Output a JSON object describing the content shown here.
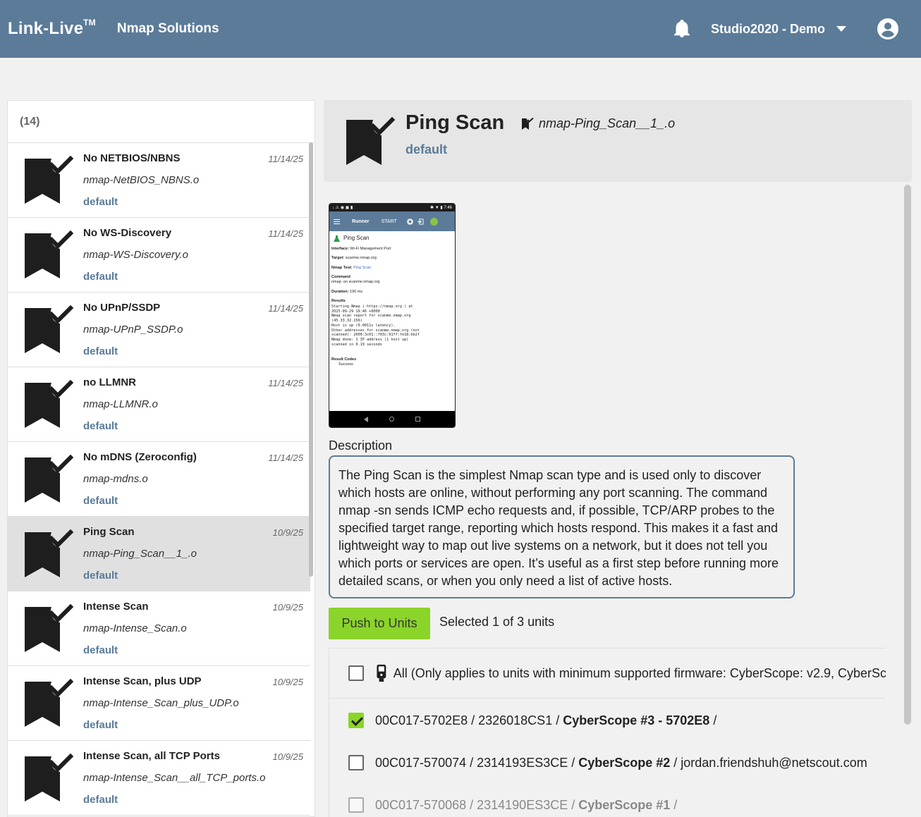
{
  "header": {
    "brand": "Link-Live",
    "brand_mark": "TM",
    "product": "Nmap Solutions",
    "org": "Studio2020 - Demo"
  },
  "list": {
    "count": "(14)",
    "items": [
      {
        "title": "No NETBIOS/NBNS",
        "file": "nmap-NetBIOS_NBNS.o",
        "tag": "default",
        "date": "11/14/25"
      },
      {
        "title": "No WS-Discovery",
        "file": "nmap-WS-Discovery.o",
        "tag": "default",
        "date": "11/14/25"
      },
      {
        "title": "No UPnP/SSDP",
        "file": "nmap-UPnP_SSDP.o",
        "tag": "default",
        "date": "11/14/25"
      },
      {
        "title": "no LLMNR",
        "file": "nmap-LLMNR.o",
        "tag": "default",
        "date": "11/14/25"
      },
      {
        "title": "No mDNS (Zeroconfig)",
        "file": "nmap-mdns.o",
        "tag": "default",
        "date": "11/14/25"
      },
      {
        "title": "Ping Scan",
        "file": "nmap-Ping_Scan__1_.o",
        "tag": "default",
        "date": "10/9/25"
      },
      {
        "title": "Intense Scan",
        "file": "nmap-Intense_Scan.o",
        "tag": "default",
        "date": "10/9/25"
      },
      {
        "title": "Intense Scan, plus UDP",
        "file": "nmap-Intense_Scan_plus_UDP.o",
        "tag": "default",
        "date": "10/9/25"
      },
      {
        "title": "Intense Scan, all TCP Ports",
        "file": "nmap-Intense_Scan__all_TCP_ports.o",
        "tag": "default",
        "date": "10/9/25"
      }
    ]
  },
  "detail": {
    "title": "Ping Scan",
    "file": "nmap-Ping_Scan__1_.o",
    "tag": "default",
    "description_label": "Description",
    "description": "The Ping Scan is the simplest Nmap scan type and is used only to discover which hosts are online, without performing any port scanning. The command nmap -sn sends ICMP echo requests and, if possible, TCP/ARP probes to the specified target range, reporting which hosts respond. This makes it a fast and lightweight way to map out live systems on a network, but it does not tell you which ports or services are open. It’s useful as a first step before running more detailed scans, or when you only need a list of active hosts.",
    "push_label": "Push to Units",
    "selected_text": "Selected 1 of 3 units"
  },
  "phone": {
    "time": "7:46",
    "appbar_title": "Runner",
    "appbar_start": "START",
    "badge": "5",
    "test_name": "Ping Scan",
    "interface_label": "Interface:",
    "interface_value": "Wi-Fi Management Port",
    "target_label": "Target:",
    "target_value": "scanme.nmap.org",
    "nmap_test_label": "Nmap Test:",
    "nmap_test_value": "Ping Scan",
    "command_label": "Command",
    "command_value": "nmap -sn scanme.nmap.org",
    "duration_label": "Duration:",
    "duration_value": "190 ms",
    "results_label": "Results",
    "results_text": "Starting Nmap ( https://nmap.org ) at\n2025-09-29 19:46 +0000\nNmap scan report for scanme.nmap.org\n(45.33.32.156)\nHost is up (0.0011s latency).\nOther addresses for scanme.nmap.org (not\nscanned): 2600:3c01::f03c:91ff:fe18:bb2f\nNmap done: 1 IP address (1 host up)\nscanned in 0.19 seconds",
    "result_codes_label": "Result Codes",
    "result_codes_value": "Success"
  },
  "units": {
    "all_label": "All (Only applies to units with minimum supported firmware: CyberScope: v2.9, CyberSc",
    "rows": [
      {
        "id": "00C017-5702E8 / 2326018CS1 /",
        "name": "CyberScope #3 - 5702E8",
        "suffix": "/",
        "checked": true
      },
      {
        "id": "00C017-570074 / 2314193ES3CE /",
        "name": "CyberScope #2",
        "suffix": "/ jordan.friendshuh@netscout.com",
        "checked": false
      },
      {
        "id": "00C017-570068 / 2314190ES3CE /",
        "name": "CyberScope #1",
        "suffix": "/",
        "checked": false
      }
    ]
  },
  "colors": {
    "header_bg": "#5b7b99",
    "accent_green": "#8bd42a",
    "tag_blue": "#5b7b99"
  }
}
